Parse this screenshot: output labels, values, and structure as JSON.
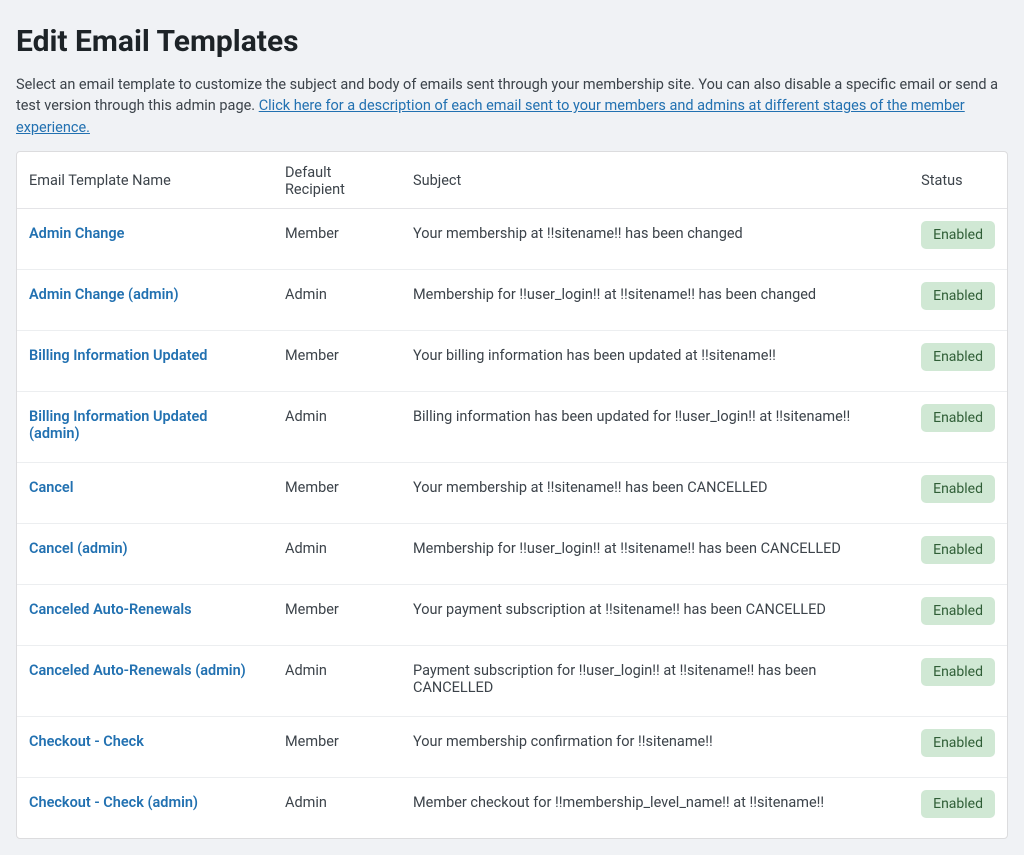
{
  "page": {
    "title": "Edit Email Templates",
    "intro_text": "Select an email template to customize the subject and body of emails sent through your membership site. You can also disable a specific email or send a test version through this admin page. ",
    "intro_link": "Click here for a description of each email sent to your members and admins at different stages of the member experience."
  },
  "table": {
    "headers": {
      "name": "Email Template Name",
      "recipient": "Default Recipient",
      "subject": "Subject",
      "status": "Status"
    },
    "status_label": "Enabled",
    "rows": [
      {
        "name": "Admin Change",
        "recipient": "Member",
        "subject": "Your membership at !!sitename!! has been changed"
      },
      {
        "name": "Admin Change (admin)",
        "recipient": "Admin",
        "subject": "Membership for !!user_login!! at !!sitename!! has been changed"
      },
      {
        "name": "Billing Information Updated",
        "recipient": "Member",
        "subject": "Your billing information has been updated at !!sitename!!"
      },
      {
        "name": "Billing Information Updated (admin)",
        "recipient": "Admin",
        "subject": "Billing information has been updated for !!user_login!! at !!sitename!!"
      },
      {
        "name": "Cancel",
        "recipient": "Member",
        "subject": "Your membership at !!sitename!! has been CANCELLED"
      },
      {
        "name": "Cancel (admin)",
        "recipient": "Admin",
        "subject": "Membership for !!user_login!! at !!sitename!! has been CANCELLED"
      },
      {
        "name": "Canceled Auto-Renewals",
        "recipient": "Member",
        "subject": "Your payment subscription at !!sitename!! has been CANCELLED"
      },
      {
        "name": "Canceled Auto-Renewals (admin)",
        "recipient": "Admin",
        "subject": "Payment subscription for !!user_login!! at !!sitename!! has been CANCELLED"
      },
      {
        "name": "Checkout - Check",
        "recipient": "Member",
        "subject": "Your membership confirmation for !!sitename!!"
      },
      {
        "name": "Checkout - Check (admin)",
        "recipient": "Admin",
        "subject": "Member checkout for !!membership_level_name!! at !!sitename!!"
      }
    ]
  }
}
